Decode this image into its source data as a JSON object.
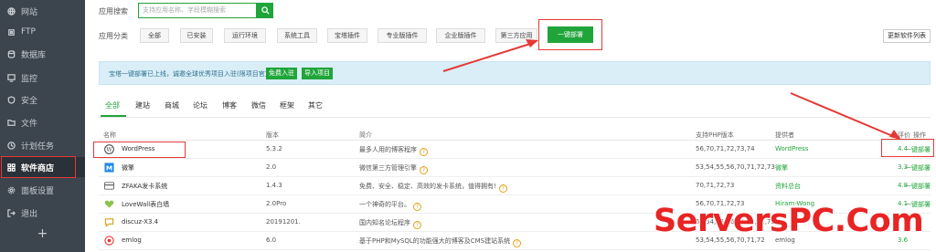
{
  "sidebar": {
    "items": [
      {
        "label": "网站",
        "icon": "globe-icon"
      },
      {
        "label": "FTP",
        "icon": "ftp-icon"
      },
      {
        "label": "数据库",
        "icon": "database-icon"
      },
      {
        "label": "监控",
        "icon": "monitor-icon"
      },
      {
        "label": "安全",
        "icon": "shield-icon"
      },
      {
        "label": "文件",
        "icon": "folder-icon"
      },
      {
        "label": "计划任务",
        "icon": "clock-icon"
      },
      {
        "label": "软件商店",
        "icon": "grid-icon"
      },
      {
        "label": "面板设置",
        "icon": "gear-icon"
      },
      {
        "label": "退出",
        "icon": "logout-icon"
      }
    ],
    "add_label": "+",
    "active": "软件商店"
  },
  "search": {
    "label": "应用搜索",
    "placeholder": "支持应用名称、字段模糊搜索"
  },
  "categories": {
    "label": "应用分类",
    "items": [
      "全部",
      "已安装",
      "运行环境",
      "系统工具",
      "宝塔插件",
      "专业版插件",
      "企业版插件",
      "第三方应用",
      "一键部署"
    ],
    "active": "一键部署"
  },
  "refresh_label": "更新软件列表",
  "notice": {
    "text": "宝塔一键部署已上线，诚邀全球优秀项目入驻(限项目官方)",
    "btn_join": "免费入驻",
    "btn_import": "导入项目"
  },
  "tabs": {
    "items": [
      "全部",
      "建站",
      "商城",
      "论坛",
      "博客",
      "微信",
      "框架",
      "其它"
    ],
    "active": "全部"
  },
  "table": {
    "headers": {
      "name": "名称",
      "version": "版本",
      "desc": "简介",
      "php": "支持PHP版本",
      "provider": "提供者",
      "score": "评价",
      "op": "操作"
    },
    "rows": [
      {
        "name": "WordPress",
        "version": "5.3.2",
        "desc": "最多人用的博客程序",
        "php": "56,70,71,72,73,74",
        "provider": "WordPress",
        "score": "4.4",
        "op": "一键部署"
      },
      {
        "name": "微擎",
        "version": "2.0",
        "desc": "微信第三方管理引擎",
        "php": "53,54,55,56,70,71,72,73",
        "provider": "微擎",
        "score": "3.3",
        "op": "一键部署"
      },
      {
        "name": "ZFAKA发卡系统",
        "version": "1.4.3",
        "desc": "免费、安全、稳定、高效的发卡系统，值得拥有!",
        "php": "70,71,72,73",
        "provider": "资料总台",
        "score": "4.8",
        "op": "一键部署"
      },
      {
        "name": "LoveWall表白墙",
        "version": "2.0Pro",
        "desc": "一个神奇的平台。",
        "php": "56,70,71,72,73",
        "provider": "Hiram-Wong",
        "score": "4.1",
        "op": "一键部署"
      },
      {
        "name": "discuz-X3.4",
        "version": "20191201.",
        "desc": "国内知名论坛程序",
        "php": "53,54,55,56,70,71,72,73",
        "provider": "",
        "score": "",
        "op": ""
      },
      {
        "name": "emlog",
        "version": "6.0",
        "desc": "基于PHP和MySQL的功能强大的博客及CMS建站系统",
        "php": "53,54,55,56,70,71,72",
        "provider": "emlog",
        "score": "3.6",
        "op": ""
      }
    ]
  },
  "watermark": "ServersPC.Com",
  "colors": {
    "sidebar_bg": "#3c444d",
    "accent": "#20a53a",
    "highlight": "#e53935",
    "notice_bg": "#d9eef7"
  }
}
